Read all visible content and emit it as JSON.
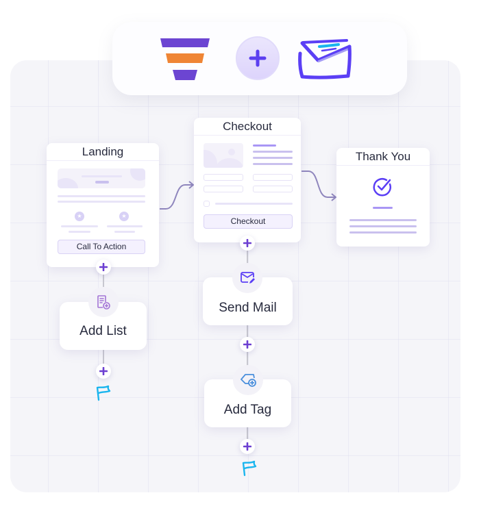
{
  "header": {
    "left_logo": "funnel-logo",
    "connector": "plus",
    "right_logo": "mail-logo"
  },
  "pages": {
    "landing": {
      "title": "Landing",
      "cta": "Call To Action"
    },
    "checkout": {
      "title": "Checkout",
      "button": "Checkout"
    },
    "thank_you": {
      "title": "Thank You"
    }
  },
  "actions": {
    "add_list": {
      "label": "Add List",
      "icon": "list-add-icon"
    },
    "send_mail": {
      "label": "Send Mail",
      "icon": "mail-edit-icon"
    },
    "add_tag": {
      "label": "Add Tag",
      "icon": "tag-add-icon"
    }
  },
  "colors": {
    "primary": "#6c3fd1",
    "accent_orange": "#ef8535",
    "mail_blue": "#5b3ff5",
    "flag": "#1ab5ee",
    "connector": "#8f86bd"
  }
}
